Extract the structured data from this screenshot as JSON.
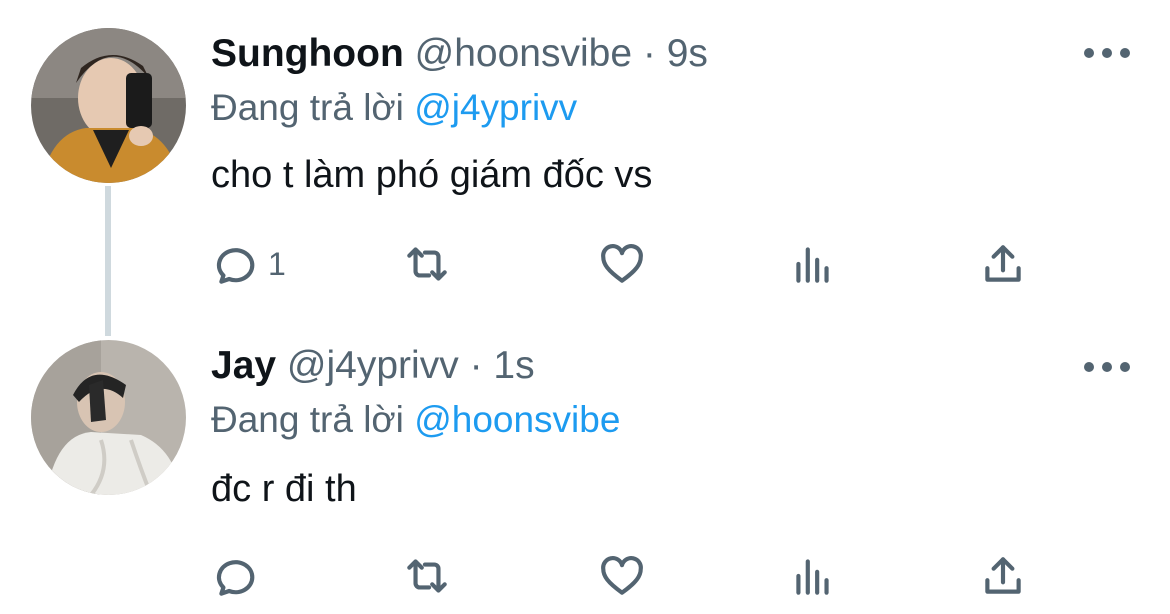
{
  "colors": {
    "text_primary": "#0f1419",
    "text_secondary": "#536471",
    "accent": "#1d9bf0",
    "thread_line": "#cfd9de"
  },
  "tweets": [
    {
      "display_name": "Sunghoon",
      "handle": "@hoonsvibe",
      "separator": "·",
      "time": "9s",
      "reply_prefix": "Đang trả lời",
      "reply_to": "@j4yprivv",
      "text": "cho t làm phó giám đốc vs",
      "reply_count": "1",
      "icons": [
        "reply-icon",
        "retweet-icon",
        "like-icon",
        "views-icon",
        "share-icon",
        "more-icon"
      ]
    },
    {
      "display_name": "Jay",
      "handle": "@j4yprivv",
      "separator": "·",
      "time": "1s",
      "reply_prefix": "Đang trả lời",
      "reply_to": "@hoonsvibe",
      "text": "đc r đi th",
      "reply_count": "",
      "icons": [
        "reply-icon",
        "retweet-icon",
        "like-icon",
        "views-icon",
        "share-icon",
        "more-icon"
      ]
    }
  ]
}
